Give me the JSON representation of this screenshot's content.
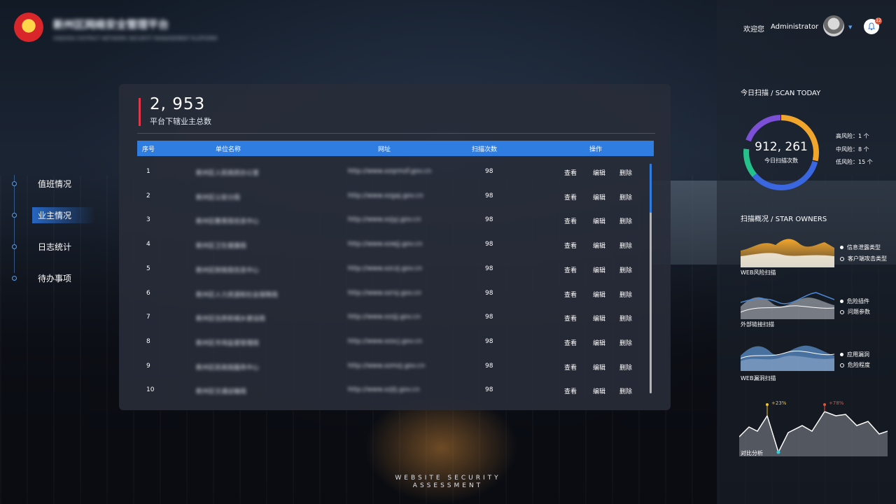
{
  "header": {
    "title": "新州区网络安全管理平台",
    "subtitle": "XINZHOU DISTRICT NETWORK SECURITY MANAGEMENT PLATFORM"
  },
  "nav": {
    "items": [
      {
        "label": "值班情况",
        "active": false
      },
      {
        "label": "业主情况",
        "active": true
      },
      {
        "label": "日志统计",
        "active": false
      },
      {
        "label": "待办事项",
        "active": false
      }
    ]
  },
  "summary": {
    "total": "2, 953",
    "label": "平台下辖业主总数"
  },
  "table": {
    "columns": [
      "序号",
      "单位名称",
      "网址",
      "扫描次数",
      "操作"
    ],
    "actions": [
      "查看",
      "编辑",
      "删除"
    ],
    "rows": [
      {
        "index": "1",
        "name": "新州区人民政府办公室",
        "url": "http://www.xzqrmzf.gov.cn",
        "scans": "98"
      },
      {
        "index": "2",
        "name": "新州区公安分局",
        "url": "http://www.xzgaj.gov.cn",
        "scans": "98"
      },
      {
        "index": "3",
        "name": "新州区教育局信息中心",
        "url": "http://www.xzjyj.gov.cn",
        "scans": "98"
      },
      {
        "index": "4",
        "name": "新州区卫生健康局",
        "url": "http://www.xzwjj.gov.cn",
        "scans": "98"
      },
      {
        "index": "5",
        "name": "新州区财政局信息中心",
        "url": "http://www.xzczj.gov.cn",
        "scans": "98"
      },
      {
        "index": "6",
        "name": "新州区人力资源和社会保障局",
        "url": "http://www.xzrsj.gov.cn",
        "scans": "98"
      },
      {
        "index": "7",
        "name": "新州区住房和城乡建设局",
        "url": "http://www.xzzjj.gov.cn",
        "scans": "98"
      },
      {
        "index": "8",
        "name": "新州区市场监督管理局",
        "url": "http://www.xzscj.gov.cn",
        "scans": "98"
      },
      {
        "index": "9",
        "name": "新州区民政局服务中心",
        "url": "http://www.xzmzj.gov.cn",
        "scans": "98"
      },
      {
        "index": "10",
        "name": "新州区交通运输局",
        "url": "http://www.xzjtj.gov.cn",
        "scans": "98"
      }
    ]
  },
  "footer_text": {
    "line1": "WEBSITE SECURITY",
    "line2": "ASSESSMENT"
  },
  "user": {
    "welcome": "欢迎您",
    "name": "Administrator",
    "notifications": "12"
  },
  "scan_today": {
    "title": "今日扫描 / SCAN TODAY",
    "value": "912, 261",
    "label": "今日扫描次数",
    "risks": [
      {
        "label": "高风险：1 个",
        "value": 1
      },
      {
        "label": "中风险：8 个",
        "value": 8
      },
      {
        "label": "低风险：15 个",
        "value": 15
      }
    ]
  },
  "overview": {
    "title": "扫描概况 / STAR OWNERS",
    "charts": [
      {
        "caption": "WEB风险扫描",
        "legend": [
          "信息泄露类型",
          "客户端攻击类型"
        ]
      },
      {
        "caption": "外部链接扫描",
        "legend": [
          "危险插件",
          "问题参数"
        ]
      },
      {
        "caption": "WEB漏洞扫描",
        "legend": [
          "应用漏洞",
          "危险程度"
        ]
      }
    ]
  },
  "compare": {
    "caption": "对比分析",
    "annotations": [
      "+23%",
      "+78%"
    ]
  },
  "colors": {
    "accent": "#2f7de0",
    "highlight": "#e0374a",
    "orange": "#f2a52b",
    "purple": "#7b4fd6"
  }
}
